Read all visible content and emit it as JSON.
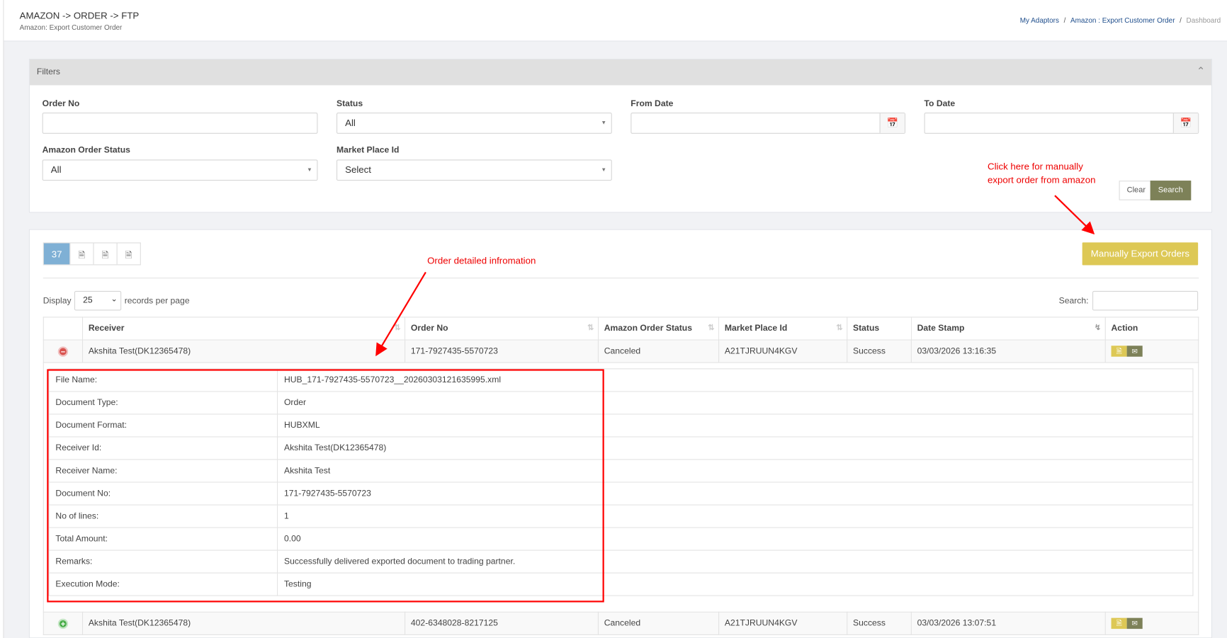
{
  "header": {
    "title": "AMAZON -> ORDER -> FTP",
    "subtitle": "Amazon: Export Customer Order",
    "breadcrumb": [
      "My Adaptors",
      "Amazon : Export Customer Order",
      "Dashboard"
    ]
  },
  "filters": {
    "title": "Filters",
    "order_no_label": "Order No",
    "order_no_value": "",
    "status_label": "Status",
    "status_value": "All",
    "from_date_label": "From Date",
    "to_date_label": "To Date",
    "amazon_status_label": "Amazon Order Status",
    "amazon_status_value": "All",
    "marketplace_label": "Market Place Id",
    "marketplace_value": "Select",
    "clear": "Clear",
    "search": "Search"
  },
  "annotations": {
    "manual_note_1": "Click here for manually",
    "manual_note_2": "export order from amazon",
    "detail_note": "Order detailed infromation"
  },
  "list": {
    "count": "37",
    "manual_export": "Manually Export Orders",
    "display_label": "Display",
    "page_size": "25",
    "records_label": "records per page",
    "search_label": "Search:"
  },
  "table": {
    "columns": [
      "Receiver",
      "Order No",
      "Amazon Order Status",
      "Market Place Id",
      "Status",
      "Date Stamp",
      "Action"
    ],
    "rows": [
      {
        "receiver": "Akshita Test(DK12365478)",
        "order_no": "171-7927435-5570723",
        "amazon_status": "Canceled",
        "marketplace": "A21TJRUUN4KGV",
        "status": "Success",
        "date": "03/03/2026 13:16:35"
      },
      {
        "receiver": "Akshita Test(DK12365478)",
        "order_no": "402-6348028-8217125",
        "amazon_status": "Canceled",
        "marketplace": "A21TJRUUN4KGV",
        "status": "Success",
        "date": "03/03/2026 13:07:51"
      }
    ],
    "details": [
      [
        "File Name:",
        "HUB_171-7927435-5570723__20260303121635995.xml"
      ],
      [
        "Document Type:",
        "Order"
      ],
      [
        "Document Format:",
        "HUBXML"
      ],
      [
        "Receiver Id:",
        "Akshita Test(DK12365478)"
      ],
      [
        "Receiver Name:",
        "Akshita Test"
      ],
      [
        "Document No:",
        "171-7927435-5570723"
      ],
      [
        "No of lines:",
        "1"
      ],
      [
        "Total Amount:",
        "0.00"
      ],
      [
        "Remarks:",
        "Successfully delivered exported document to trading partner."
      ],
      [
        "Execution Mode:",
        "Testing"
      ]
    ]
  },
  "colors": {
    "accent": "#ddc855",
    "search_btn": "#7d8158",
    "count_bg": "#7fb0d5",
    "annotation": "#ff0000"
  }
}
